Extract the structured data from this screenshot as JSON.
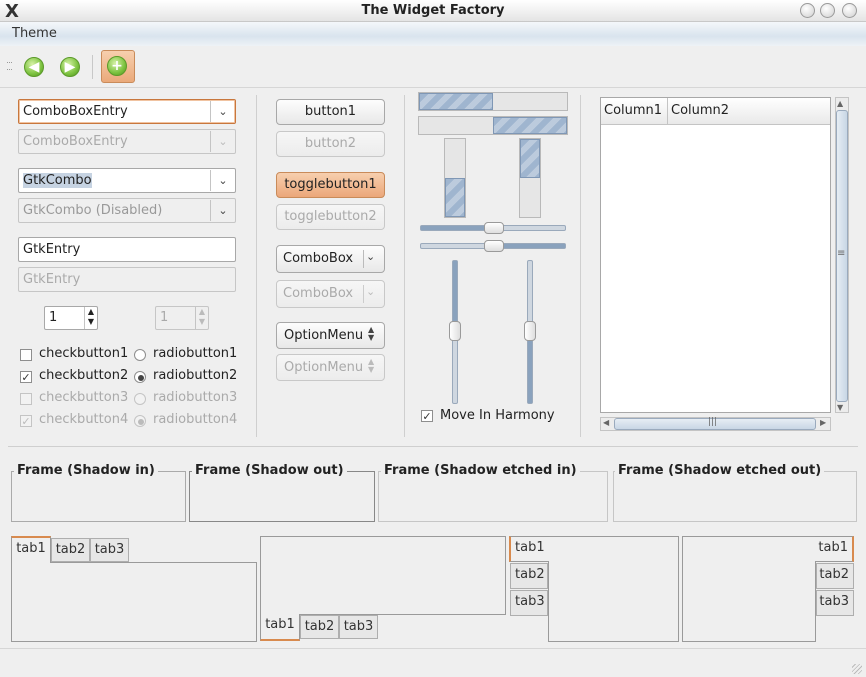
{
  "window": {
    "title": "The Widget Factory",
    "close_glyph": "X"
  },
  "menubar": {
    "theme": "Theme"
  },
  "toolbar": {
    "back_icon": "arrow-left-icon",
    "forward_icon": "arrow-right-icon",
    "add_icon": "add-icon"
  },
  "col1": {
    "combo_entry_1": "ComboBoxEntry",
    "combo_entry_2": "ComboBoxEntry",
    "gtkcombo": "GtkCombo",
    "gtkcombo_disabled": "GtkCombo (Disabled)",
    "entry": "GtkEntry",
    "entry_disabled": "GtkEntry",
    "spin_value": "1",
    "spin_disabled_value": "1",
    "checks": [
      {
        "label": "checkbutton1",
        "checked": false,
        "disabled": false
      },
      {
        "label": "checkbutton2",
        "checked": true,
        "disabled": false
      },
      {
        "label": "checkbutton3",
        "checked": false,
        "disabled": true
      },
      {
        "label": "checkbutton4",
        "checked": true,
        "disabled": true
      }
    ],
    "radios": [
      {
        "label": "radiobutton1",
        "selected": false,
        "disabled": false
      },
      {
        "label": "radiobutton2",
        "selected": true,
        "disabled": false
      },
      {
        "label": "radiobutton3",
        "selected": false,
        "disabled": true
      },
      {
        "label": "radiobutton4",
        "selected": true,
        "disabled": true
      }
    ]
  },
  "col2": {
    "button1": "button1",
    "button2": "button2",
    "toggle1": "togglebutton1",
    "toggle2": "togglebutton2",
    "combobox1": "ComboBox",
    "combobox2": "ComboBox",
    "optionmenu1": "OptionMenu",
    "optionmenu2": "OptionMenu"
  },
  "col3": {
    "move_in_harmony": "Move In Harmony",
    "move_in_harmony_checked": true,
    "hprogress": [
      {
        "fraction": 0.5
      },
      {
        "fraction": 0.5,
        "inverted": true
      }
    ],
    "vprogress": [
      {
        "fraction": 0.5,
        "from_bottom": true
      },
      {
        "fraction": 0.5
      }
    ],
    "hscale_values": [
      0.5,
      0.5
    ],
    "vscale_values": [
      0.5,
      0.5
    ]
  },
  "tree": {
    "col1": "Column1",
    "col2": "Column2",
    "hscroll_grip": "|||",
    "vscroll_grip": "≡"
  },
  "frames": {
    "in": "Frame (Shadow in)",
    "out": "Frame (Shadow out)",
    "etched_in": "Frame (Shadow etched in)",
    "etched_out": "Frame (Shadow etched out)"
  },
  "notebooks": {
    "tabs": [
      "tab1",
      "tab2",
      "tab3"
    ]
  }
}
